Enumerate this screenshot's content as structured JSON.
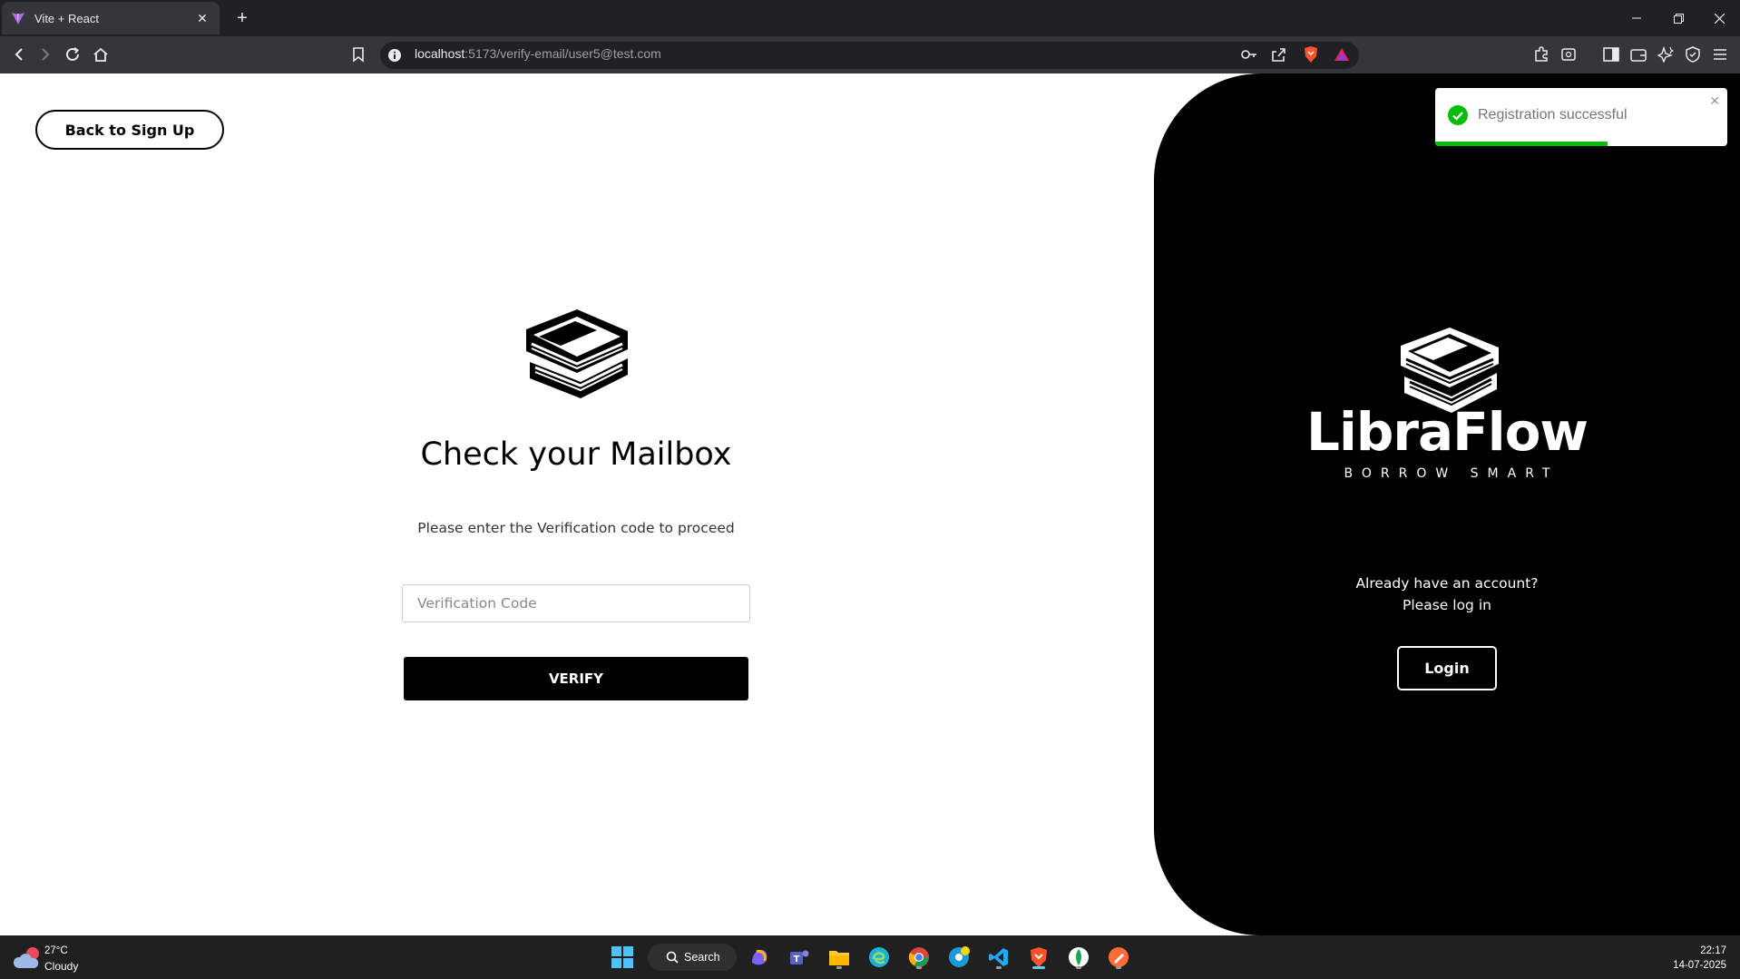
{
  "browser": {
    "tab_title": "Vite + React",
    "url_host": "localhost",
    "url_path": ":5173/verify-email/user5@test.com"
  },
  "page": {
    "back_button": "Back to Sign Up",
    "heading": "Check your Mailbox",
    "subtext": "Please enter the Verification code to proceed",
    "code_placeholder": "Verification Code",
    "code_value": "",
    "verify_button": "VERIFY"
  },
  "brand_panel": {
    "brand": "LibraFlow",
    "tagline": "BORROW SMART",
    "account_line1": "Already have an account?",
    "account_line2": "Please log in",
    "login_button": "Login"
  },
  "toast": {
    "message": "Registration successful",
    "status_color": "#07bc0c",
    "progress_remaining": 0.59
  },
  "taskbar": {
    "temperature": "27°C",
    "condition": "Cloudy",
    "search_label": "Search",
    "time": "22:17",
    "date": "14-07-2025"
  },
  "colors": {
    "accent": "#000000",
    "panel_bg": "#000000",
    "success": "#07bc0c"
  }
}
